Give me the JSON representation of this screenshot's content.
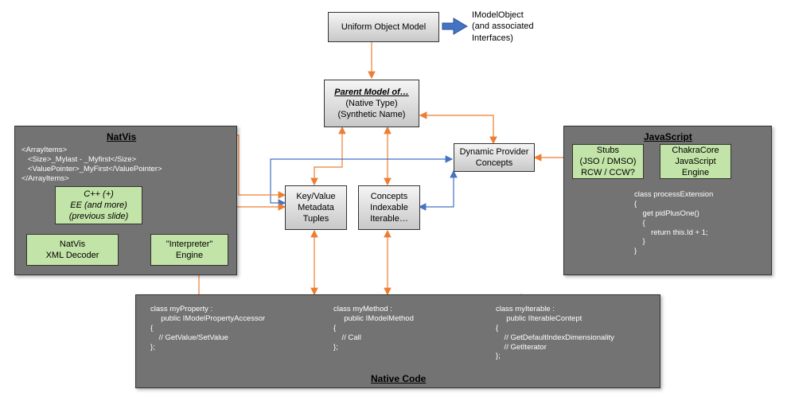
{
  "topBox": "Uniform Object Model",
  "sideLabel": {
    "l1": "IModelObject",
    "l2": "(and associated",
    "l3": "Interfaces)"
  },
  "parentBox": {
    "title": "Parent Model of…",
    "l2": "(Native Type)",
    "l3": "(Synthetic Name)"
  },
  "dynConcepts": {
    "l1": "Dynamic Provider",
    "l2": "Concepts"
  },
  "kvBox": {
    "l1": "Key/Value",
    "l2": "Metadata",
    "l3": "Tuples"
  },
  "conceptsBox": {
    "l1": "Concepts",
    "l2": "Indexable",
    "l3": "Iterable…"
  },
  "natvis": {
    "title": "NatVis",
    "code": "<ArrayItems>\n   <Size>_Mylast - _Myfirst</Size>\n   <ValuePointer>_MyFirst</ValuePointer>\n</ArrayItems>",
    "cppBox": {
      "l1": "C++ (+)",
      "l2": "EE (and more)",
      "l3": "(previous slide)"
    },
    "xmlBox": {
      "l1": "NatVis",
      "l2": "XML Decoder"
    },
    "interpBox": {
      "l1": "\"Interpreter\"",
      "l2": "Engine"
    }
  },
  "js": {
    "title": "JavaScript",
    "stubs": {
      "l1": "Stubs",
      "l2": "(JSO / DMSO)",
      "l3": "RCW / CCW?"
    },
    "chakra": {
      "l1": "ChakraCore",
      "l2": "JavaScript",
      "l3": "Engine"
    },
    "code": "class processExtension\n{\n    get pidPlusOne()\n    {\n        return this.Id + 1;\n    }\n}"
  },
  "native": {
    "title": "Native Code",
    "prop": "class myProperty :\n     public IModelPropertyAccessor\n{\n    // GetValue/SetValue\n};",
    "method": "class myMethod :\n     public IModelMethod\n{\n    // Call\n};",
    "iter": "class myIterable :\n     public IIterableContept\n{\n    // GetDefaultIndexDimensionality\n    // GetIterator\n};"
  }
}
